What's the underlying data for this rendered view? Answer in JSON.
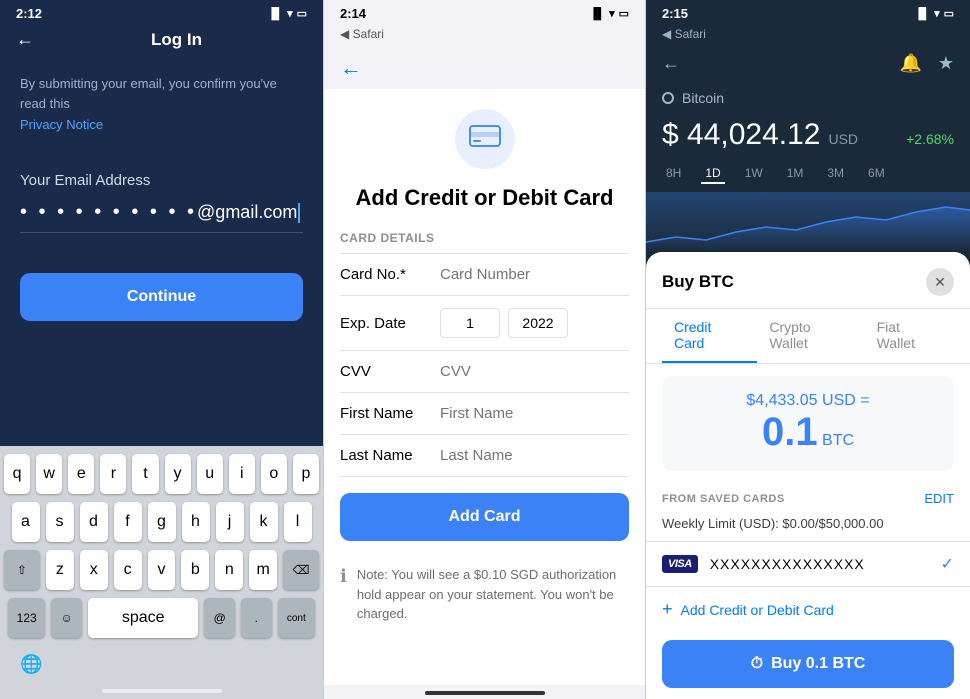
{
  "panel1": {
    "status_time": "2:12",
    "title": "Log In",
    "privacy_text": "By submitting your email, you confirm you've read this",
    "privacy_link": "Privacy Notice",
    "email_label": "Your Email Address",
    "email_placeholder": "••••••••••",
    "email_suffix": "@gmail.com",
    "continue_label": "Continue",
    "keyboard": {
      "row1": [
        "q",
        "w",
        "e",
        "r",
        "t",
        "y",
        "u",
        "i",
        "o",
        "p"
      ],
      "row2": [
        "a",
        "s",
        "d",
        "f",
        "g",
        "h",
        "j",
        "k",
        "l"
      ],
      "row3": [
        "z",
        "x",
        "c",
        "v",
        "b",
        "n",
        "m"
      ],
      "num_label": "123",
      "space_label": "space",
      "at_label": "@",
      "period_label": ".",
      "continue_label": "continue"
    }
  },
  "panel2": {
    "status_time": "2:14",
    "browser_back": "◀ Safari",
    "title": "Add Credit or Debit Card",
    "section_label": "CARD DETAILS",
    "card_no_label": "Card No.*",
    "card_no_placeholder": "Card Number",
    "exp_date_label": "Exp. Date",
    "exp_month_value": "1",
    "exp_year_value": "2022",
    "cvv_label": "CVV",
    "cvv_placeholder": "CVV",
    "first_name_label": "First Name",
    "first_name_placeholder": "First Name",
    "last_name_label": "Last Name",
    "last_name_placeholder": "Last Name",
    "add_card_button": "Add Card",
    "note_text": "Note: You will see a $0.10 SGD authorization hold appear on your statement. You won't be charged."
  },
  "panel3": {
    "status_time": "2:15",
    "browser_back": "◀ Safari",
    "btc_name": "Bitcoin",
    "btc_price": "$ 44,024.12",
    "btc_currency": "USD",
    "btc_change": "+2.68%",
    "chart_tabs": [
      "8H",
      "1D",
      "1W",
      "1M",
      "3M",
      "6M"
    ],
    "active_chart_tab": "1D",
    "modal": {
      "title": "Buy BTC",
      "tabs": [
        "Credit Card",
        "Crypto Wallet",
        "Fiat Wallet"
      ],
      "active_tab": "Credit Card",
      "usd_amount": "$4,433.05 USD =",
      "btc_amount": "0.1",
      "btc_unit": "BTC",
      "saved_cards_label": "FROM SAVED CARDS",
      "edit_label": "EDIT",
      "weekly_limit": "Weekly Limit (USD): $0.00/$50,000.00",
      "card_number": "XXXXXXXXXXXXXXX",
      "add_card_text": "Add Credit or Debit Card",
      "buy_button": "Buy 0.1 BTC"
    }
  }
}
